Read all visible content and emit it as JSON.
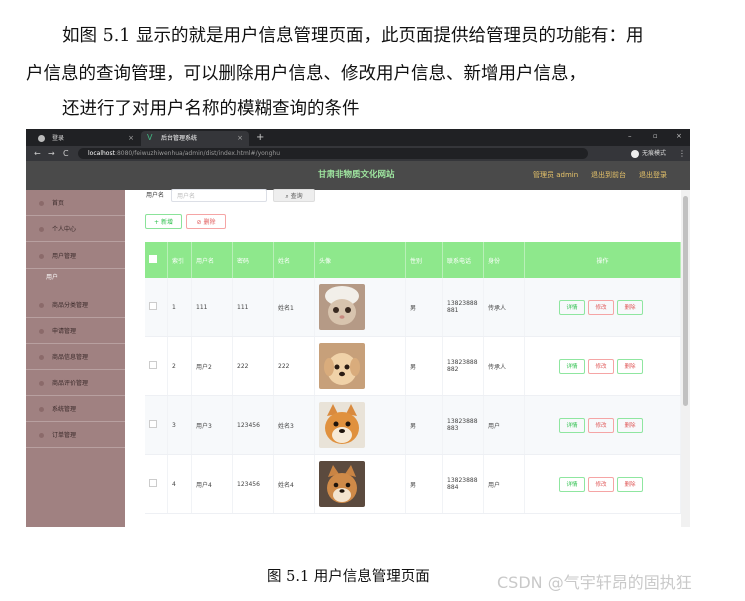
{
  "document": {
    "paragraph1": "如图 5.1 显示的就是用户信息管理页面，此页面提供给管理员的功能有：用",
    "paragraph2": "户信息的查询管理，可以删除用户信息、修改用户信息、新增用户信息，",
    "paragraph3": "还进行了对用户名称的模糊查询的条件",
    "caption": "图 5.1  用户信息管理页面",
    "watermark": "CSDN @气宇轩昂的固执狂"
  },
  "browser": {
    "tabs": [
      {
        "label": "登录",
        "close": "×"
      },
      {
        "label": "后台管理系统",
        "close": "×"
      }
    ],
    "new_tab": "+",
    "window_controls": {
      "minimize": "–",
      "restore": "▫",
      "close": "×"
    },
    "nav": {
      "back": "←",
      "forward": "→",
      "reload": "C"
    },
    "url_host": "localhost",
    "url_path": ":8080/feiwuzhiwenhua/admin/dist/index.html#/yonghu",
    "incognito_label": "无痕模式",
    "menu": "⋮"
  },
  "app": {
    "site_title": "甘肃非物质文化网站",
    "admin_label": "管理员 admin",
    "back_to_front": "退出到前台",
    "logout": "退出登录"
  },
  "sidebar": {
    "items": [
      "首页",
      "个人中心",
      "用户管理",
      "商品分类管理",
      "申请管理",
      "商品信息管理",
      "商品评价管理",
      "系统管理",
      "订单管理"
    ],
    "sub_user": "用户"
  },
  "search": {
    "label": "用户名",
    "placeholder": "用户名",
    "button": "⌕ 查询"
  },
  "toolbar": {
    "add": "+ 新增",
    "delete": "⊘ 删除"
  },
  "table": {
    "headers": [
      "",
      "索引",
      "用户名",
      "密码",
      "姓名",
      "头像",
      "性别",
      "联系电话",
      "身份",
      "操作"
    ],
    "rows": [
      {
        "index": "1",
        "username": "111",
        "password": "111",
        "name": "姓名1",
        "gender": "男",
        "phone1": "13823888",
        "phone2": "881",
        "role": "传承人"
      },
      {
        "index": "2",
        "username": "用户2",
        "password": "222",
        "name": "222",
        "gender": "男",
        "phone1": "13823888",
        "phone2": "882",
        "role": "传承人"
      },
      {
        "index": "3",
        "username": "用户3",
        "password": "123456",
        "name": "姓名3",
        "gender": "男",
        "phone1": "13823888",
        "phone2": "883",
        "role": "用户"
      },
      {
        "index": "4",
        "username": "用户4",
        "password": "123456",
        "name": "姓名4",
        "gender": "男",
        "phone1": "13823888",
        "phone2": "884",
        "role": "用户"
      }
    ],
    "ops": {
      "detail": "详情",
      "edit": "修改",
      "delete": "删除"
    }
  },
  "colors": {
    "sidebar": "#a08181",
    "header": "#4a4a4a",
    "title": "#9fe6a0",
    "table_header": "#8ee88c"
  }
}
